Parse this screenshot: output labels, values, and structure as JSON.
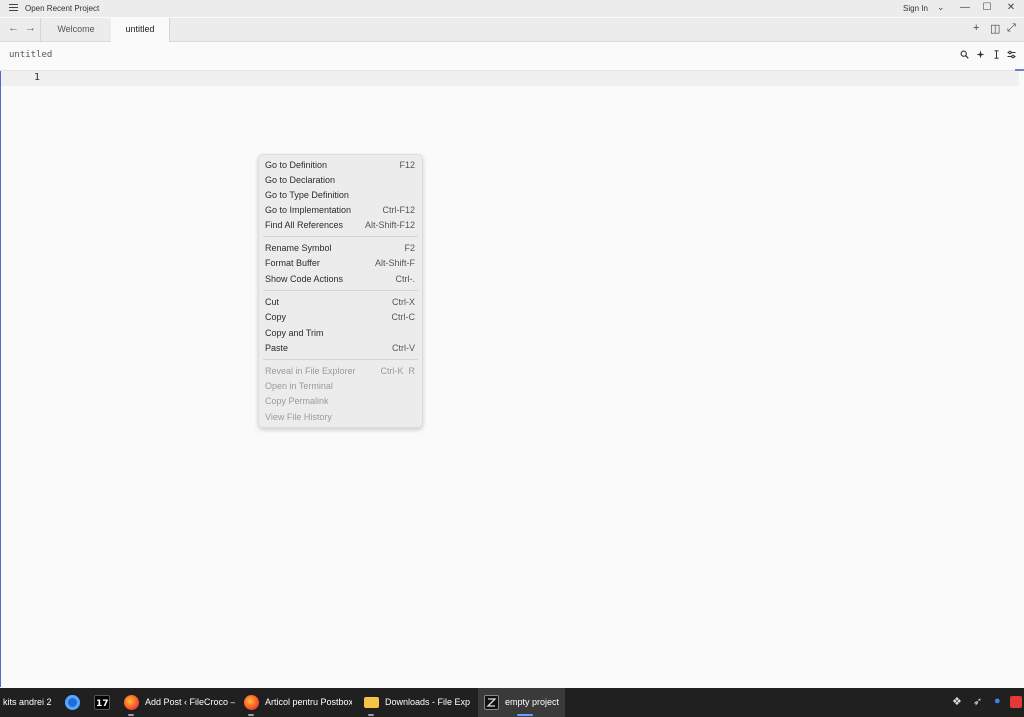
{
  "titlebar": {
    "title": "Open Recent Project",
    "sign_in": "Sign In",
    "chevron": "⌄",
    "minimize": "—",
    "maximize": "☐",
    "close": "✕"
  },
  "tabs": {
    "back": "←",
    "forward": "→",
    "items": [
      {
        "label": "Welcome"
      },
      {
        "label": "untitled"
      }
    ],
    "new_tab": "+",
    "split": "◫",
    "zoom": "⤢"
  },
  "breadcrumb": {
    "label": "untitled"
  },
  "editor": {
    "line_number": "1"
  },
  "context_menu": {
    "groups": [
      [
        {
          "label": "Go to Definition",
          "shortcut": "F12"
        },
        {
          "label": "Go to Declaration",
          "shortcut": ""
        },
        {
          "label": "Go to Type Definition",
          "shortcut": ""
        },
        {
          "label": "Go to Implementation",
          "shortcut": "Ctrl-F12"
        },
        {
          "label": "Find All References",
          "shortcut": "Alt-Shift-F12"
        }
      ],
      [
        {
          "label": "Rename Symbol",
          "shortcut": "F2"
        },
        {
          "label": "Format Buffer",
          "shortcut": "Alt-Shift-F"
        },
        {
          "label": "Show Code Actions",
          "shortcut": "Ctrl-."
        }
      ],
      [
        {
          "label": "Cut",
          "shortcut": "Ctrl-X"
        },
        {
          "label": "Copy",
          "shortcut": "Ctrl-C"
        },
        {
          "label": "Copy and Trim",
          "shortcut": ""
        },
        {
          "label": "Paste",
          "shortcut": "Ctrl-V"
        }
      ],
      [
        {
          "label": "Reveal in File Explorer",
          "shortcut": "Ctrl-K  R",
          "disabled": true
        },
        {
          "label": "Open in Terminal",
          "shortcut": "",
          "disabled": true
        },
        {
          "label": "Copy Permalink",
          "shortcut": "",
          "disabled": true
        },
        {
          "label": "View File History",
          "shortcut": "",
          "disabled": true
        }
      ]
    ]
  },
  "taskbar": {
    "left_label": "kits andrei 2",
    "apps": [
      {
        "label": "Add Post ‹ FileCroco –",
        "icon": "firefox-icon"
      },
      {
        "label": "Articol pentru Postbox",
        "icon": "firefox-icon"
      },
      {
        "label": "Downloads - File Explorer",
        "icon": "folder-icon"
      },
      {
        "label": "empty project",
        "icon": "zed-icon"
      }
    ],
    "colors": {
      "background": "#202020",
      "active": "#3a3a3a"
    }
  }
}
